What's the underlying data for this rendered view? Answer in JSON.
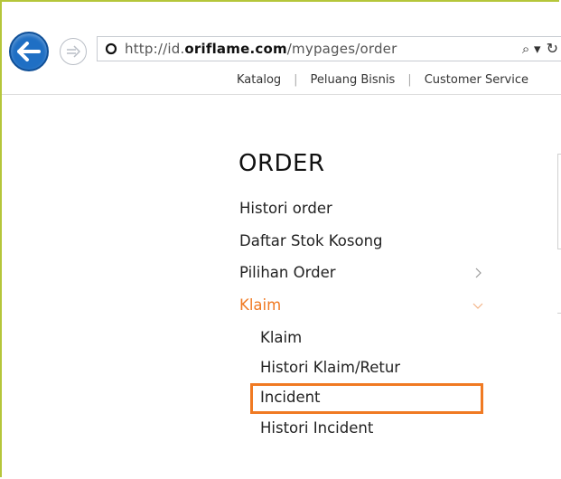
{
  "browser": {
    "url_prefix": "http://id.",
    "url_domain": "oriflame.com",
    "url_path": "/mypages/order",
    "search_glyph": "⌕ ▾",
    "refresh_glyph": "↻"
  },
  "topnav": {
    "items": [
      "Katalog",
      "Peluang Bisnis",
      "Customer Service"
    ],
    "separator": "|"
  },
  "page": {
    "title": "ORDER",
    "menu": [
      {
        "label": "Histori order"
      },
      {
        "label": "Daftar Stok Kosong"
      },
      {
        "label": "Pilihan Order"
      },
      {
        "label": "Klaim"
      }
    ],
    "submenu": [
      "Klaim",
      "Histori Klaim/Retur",
      "Incident",
      "Histori Incident"
    ],
    "highlighted": "Incident"
  },
  "colors": {
    "accent": "#f07a23",
    "back_button": "#1f6fc4",
    "frame": "#b5c63a"
  }
}
